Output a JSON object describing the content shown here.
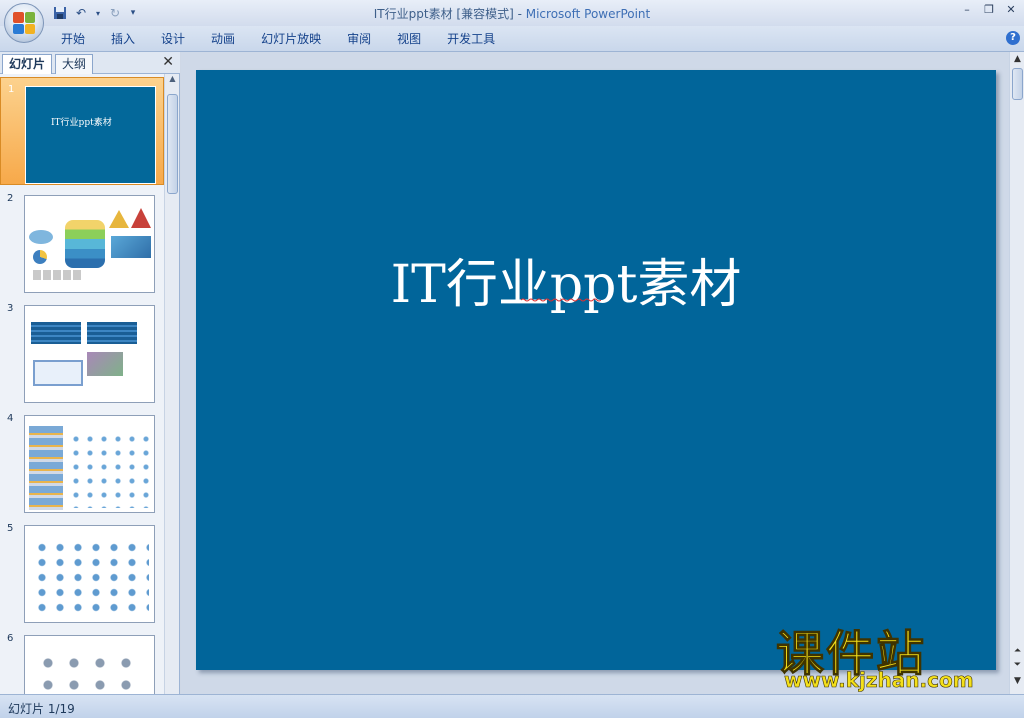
{
  "window": {
    "title_doc": "IT行业ppt素材 [兼容模式]",
    "title_sep": " - ",
    "title_app": "Microsoft PowerPoint"
  },
  "quick_access": {
    "icons": [
      "save-icon",
      "undo-icon",
      "redo-icon",
      "customize-icon"
    ]
  },
  "ribbon": {
    "tabs": [
      "开始",
      "插入",
      "设计",
      "动画",
      "幻灯片放映",
      "审阅",
      "视图",
      "开发工具"
    ],
    "help_label": "?"
  },
  "left_pane": {
    "tab_slides": "幻灯片",
    "tab_outline": "大纲",
    "close_label": "✕",
    "thumbnails": [
      {
        "num": "1",
        "title": "IT行业ppt素材",
        "selected": true
      },
      {
        "num": "2"
      },
      {
        "num": "3"
      },
      {
        "num": "4"
      },
      {
        "num": "5"
      },
      {
        "num": "6"
      }
    ]
  },
  "slide": {
    "title": "IT行业ppt素材",
    "background": "#01659a"
  },
  "status": {
    "text": "幻灯片 1/19"
  },
  "watermark": {
    "title": "课件站",
    "url": "www.kjzhan.com"
  },
  "colors": {
    "accent": "#f7a94a",
    "slide_bg": "#01659a",
    "watermark": "#f4e01a"
  }
}
